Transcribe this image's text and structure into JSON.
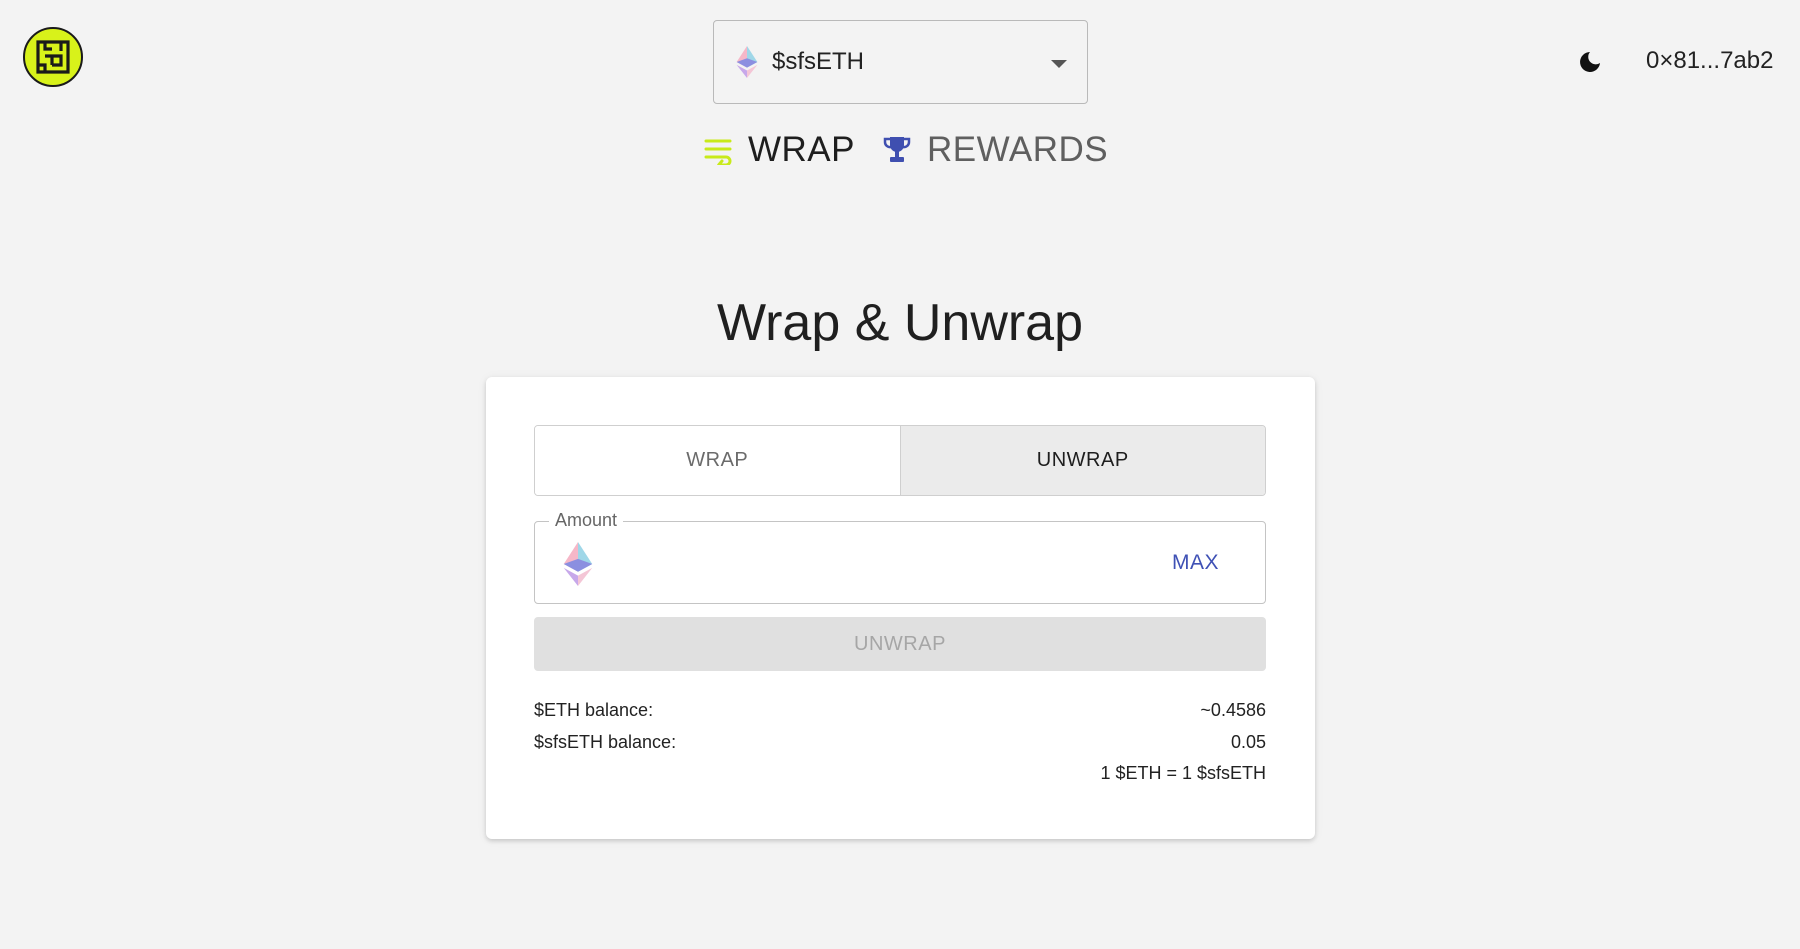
{
  "header": {
    "logo_icon": "maze-logo-icon",
    "token_select": {
      "value": "$sfsETH",
      "icon": "ethereum-icon"
    },
    "theme_icon": "moon-icon",
    "wallet_address": "0×81...7ab2"
  },
  "nav": {
    "items": [
      {
        "label": "WRAP",
        "icon": "wrap-icon",
        "color": "#c8ea1a"
      },
      {
        "label": "REWARDS",
        "icon": "trophy-icon",
        "color": "#3f4fb0"
      }
    ]
  },
  "main": {
    "title": "Wrap & Unwrap",
    "toggle": {
      "wrap_label": "WRAP",
      "unwrap_label": "UNWRAP",
      "selected": "UNWRAP"
    },
    "amount": {
      "legend": "Amount",
      "value": "",
      "max_label": "MAX"
    },
    "action_button": "UNWRAP",
    "info": {
      "eth_balance_label": "$ETH balance:",
      "eth_balance_value": "~0.4586",
      "sfseth_balance_label": "$sfsETH balance:",
      "sfseth_balance_value": "0.05",
      "rate": "1 $ETH = 1 $sfsETH"
    }
  },
  "colors": {
    "accent": "#3f51b5",
    "brand": "#d8f21a",
    "background": "#f3f3f3"
  }
}
